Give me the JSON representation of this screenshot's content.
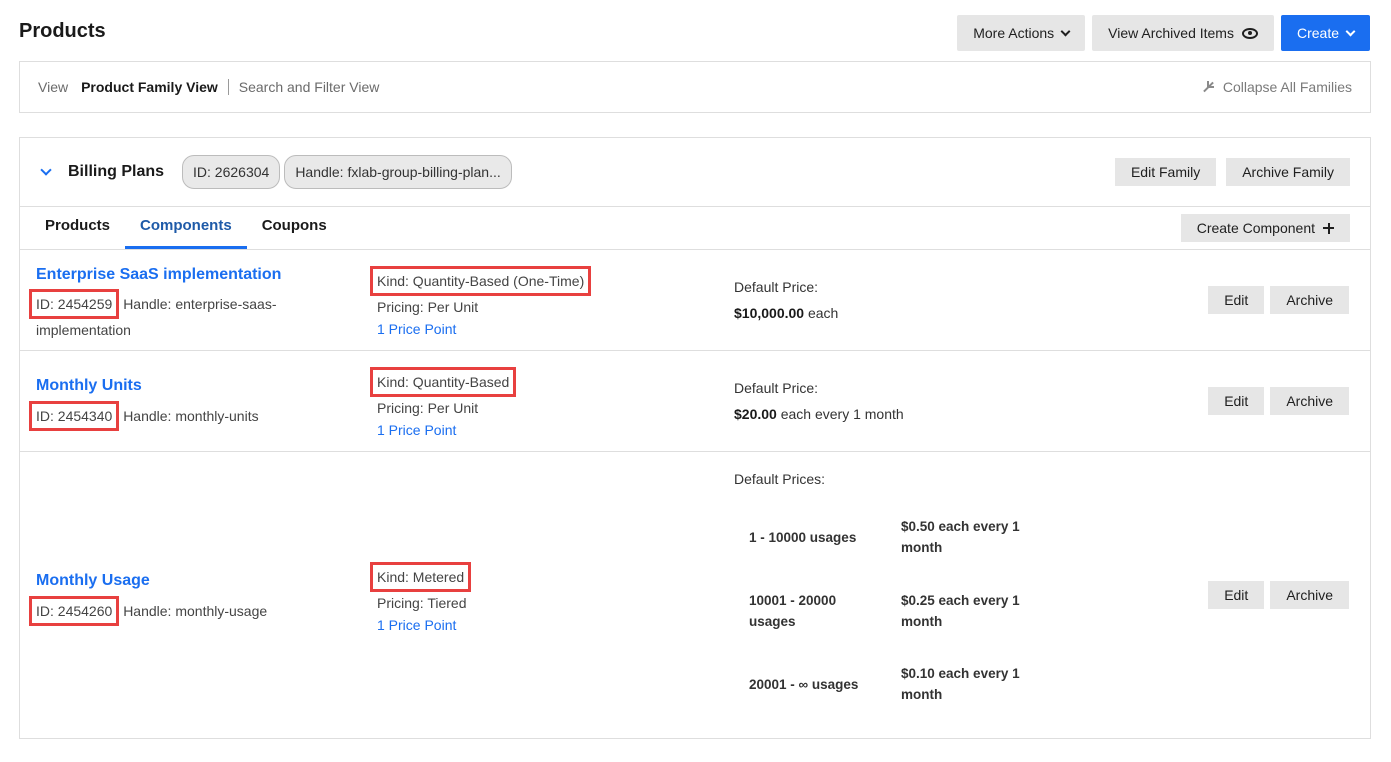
{
  "page": {
    "title": "Products"
  },
  "top_actions": {
    "more_actions": "More Actions",
    "view_archived": "View Archived Items",
    "create": "Create"
  },
  "view_bar": {
    "label": "View",
    "active": "Product Family View",
    "other": "Search and Filter View",
    "collapse_all": "Collapse All Families"
  },
  "family": {
    "name": "Billing Plans",
    "id_pill": "ID: 2626304",
    "handle_pill": "Handle: fxlab-group-billing-plan...",
    "edit": "Edit Family",
    "archive": "Archive Family"
  },
  "tabs": [
    {
      "label": "Products"
    },
    {
      "label": "Components"
    },
    {
      "label": "Coupons"
    }
  ],
  "create_component": "Create Component",
  "components": [
    {
      "name": "Enterprise SaaS implementation",
      "id": "ID: 2454259",
      "handle_line1": "Handle: enterprise-saas-",
      "handle_line2": "implementation",
      "kind": "Kind: Quantity-Based (One-Time)",
      "pricing": "Pricing: Per Unit",
      "price_points": "1 Price Point",
      "price_label": "Default Price:",
      "price_amount": "$10,000.00",
      "price_suffix": "each",
      "edit": "Edit",
      "archive": "Archive"
    },
    {
      "name": "Monthly Units",
      "id": "ID: 2454340",
      "handle_line1": "Handle: monthly-units",
      "kind": "Kind: Quantity-Based",
      "pricing": "Pricing: Per Unit",
      "price_points": "1 Price Point",
      "price_label": "Default Price:",
      "price_amount": "$20.00",
      "price_suffix": "each every 1 month",
      "edit": "Edit",
      "archive": "Archive"
    },
    {
      "name": "Monthly Usage",
      "id": "ID: 2454260",
      "handle_line1": "Handle: monthly-usage",
      "kind": "Kind: Metered",
      "pricing": "Pricing: Tiered",
      "price_points": "1 Price Point",
      "price_label": "Default Prices:",
      "tiers": [
        {
          "range_l1": "1 - 10000 usages",
          "range_l2": "",
          "price_l1": "$0.50 each every 1",
          "price_l2": "month"
        },
        {
          "range_l1": "10001 - 20000",
          "range_l2": "usages",
          "price_l1": "$0.25 each every 1",
          "price_l2": "month"
        },
        {
          "range_l1": "20001 - ∞ usages",
          "range_l2": "",
          "price_l1": "$0.10 each every 1",
          "price_l2": "month"
        }
      ],
      "edit": "Edit",
      "archive": "Archive"
    }
  ],
  "colors": {
    "accent": "#1a6ef0",
    "highlight": "#e8403f",
    "button_gray": "#e6e6e6"
  }
}
